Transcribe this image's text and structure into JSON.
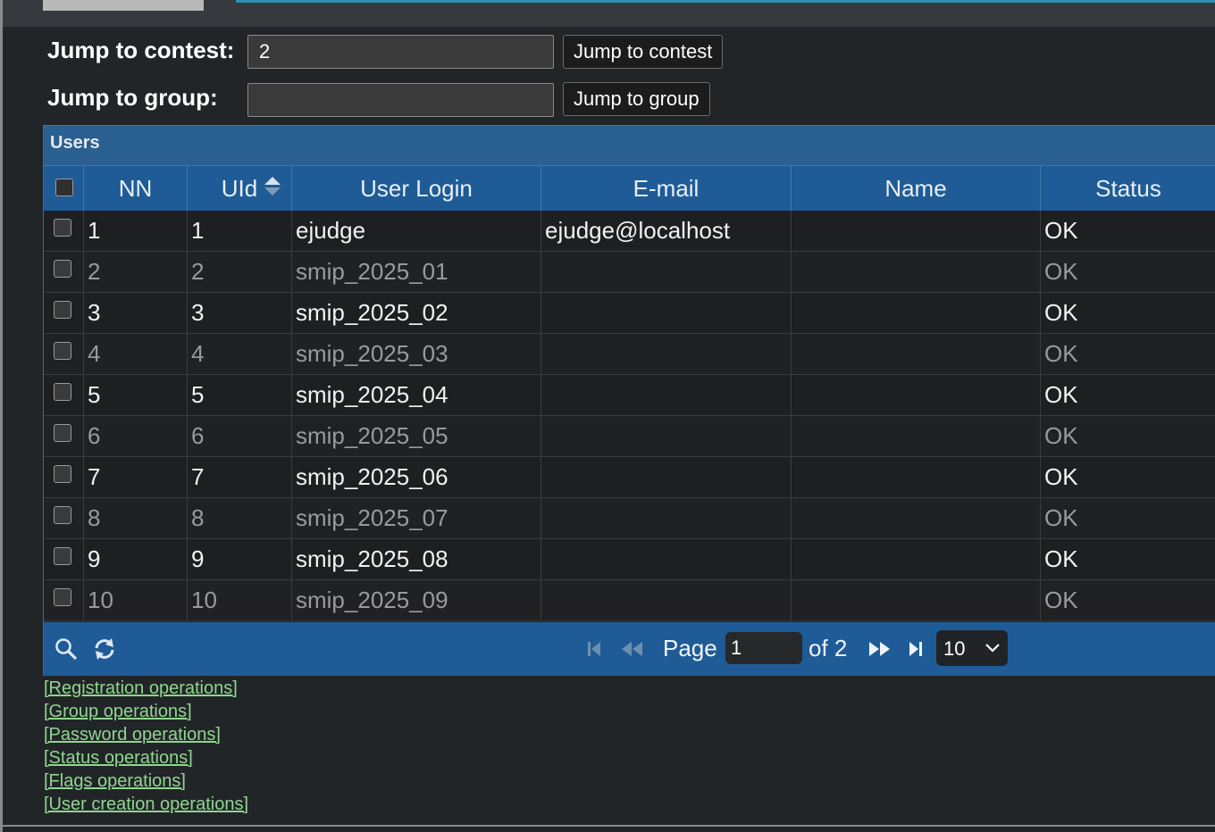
{
  "jump": {
    "contest_label": "Jump to contest:",
    "contest_value": "2",
    "contest_button": "Jump to contest",
    "group_label": "Jump to group:",
    "group_value": "",
    "group_button": "Jump to group"
  },
  "grid": {
    "title": "Users",
    "columns": [
      "NN",
      "UId",
      "User Login",
      "E-mail",
      "Name",
      "Status"
    ],
    "rows": [
      {
        "nn": "1",
        "uid": "1",
        "login": "ejudge",
        "email": "ejudge@localhost",
        "name": "",
        "status": "OK"
      },
      {
        "nn": "2",
        "uid": "2",
        "login": "smip_2025_01",
        "email": "",
        "name": "",
        "status": "OK"
      },
      {
        "nn": "3",
        "uid": "3",
        "login": "smip_2025_02",
        "email": "",
        "name": "",
        "status": "OK"
      },
      {
        "nn": "4",
        "uid": "4",
        "login": "smip_2025_03",
        "email": "",
        "name": "",
        "status": "OK"
      },
      {
        "nn": "5",
        "uid": "5",
        "login": "smip_2025_04",
        "email": "",
        "name": "",
        "status": "OK"
      },
      {
        "nn": "6",
        "uid": "6",
        "login": "smip_2025_05",
        "email": "",
        "name": "",
        "status": "OK"
      },
      {
        "nn": "7",
        "uid": "7",
        "login": "smip_2025_06",
        "email": "",
        "name": "",
        "status": "OK"
      },
      {
        "nn": "8",
        "uid": "8",
        "login": "smip_2025_07",
        "email": "",
        "name": "",
        "status": "OK"
      },
      {
        "nn": "9",
        "uid": "9",
        "login": "smip_2025_08",
        "email": "",
        "name": "",
        "status": "OK"
      },
      {
        "nn": "10",
        "uid": "10",
        "login": "smip_2025_09",
        "email": "",
        "name": "",
        "status": "OK"
      }
    ]
  },
  "pager": {
    "page_label": "Page",
    "page_value": "1",
    "of_label": "of 2",
    "page_size": "10",
    "icons": [
      "search-icon",
      "refresh-icon",
      "first-page-icon",
      "prev-page-icon",
      "next-page-icon",
      "last-page-icon",
      "chevron-down-icon"
    ]
  },
  "operations": [
    "[Registration operations]",
    "[Group operations]",
    "[Password operations]",
    "[Status operations]",
    "[Flags operations]",
    "[User creation operations]"
  ],
  "colors": {
    "accent": "#1f5b96",
    "title_bar": "#2a5f91",
    "link": "#8fd68f",
    "background": "#222528"
  }
}
